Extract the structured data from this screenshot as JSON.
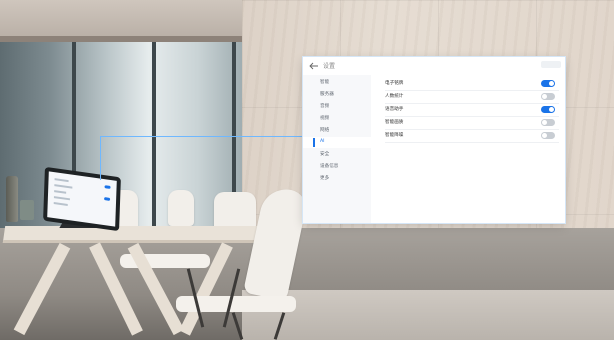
{
  "window": {
    "title": "设置",
    "accent_color": "#1a73e8"
  },
  "sidebar": {
    "items": [
      {
        "label": "智能",
        "active": false
      },
      {
        "label": "服务器",
        "active": false
      },
      {
        "label": "音频",
        "active": false
      },
      {
        "label": "视频",
        "active": false
      },
      {
        "label": "网络",
        "active": false
      },
      {
        "label": "AI",
        "active": true
      },
      {
        "label": "安全",
        "active": false
      },
      {
        "label": "设备信息",
        "active": false
      },
      {
        "label": "更多",
        "active": false
      }
    ]
  },
  "main": {
    "rows": [
      {
        "label": "电子铭牌",
        "enabled": true
      },
      {
        "label": "人数统计",
        "enabled": false
      },
      {
        "label": "语音助手",
        "enabled": true
      },
      {
        "label": "智能画质",
        "enabled": false
      },
      {
        "label": "智能降噪",
        "enabled": false
      }
    ]
  }
}
